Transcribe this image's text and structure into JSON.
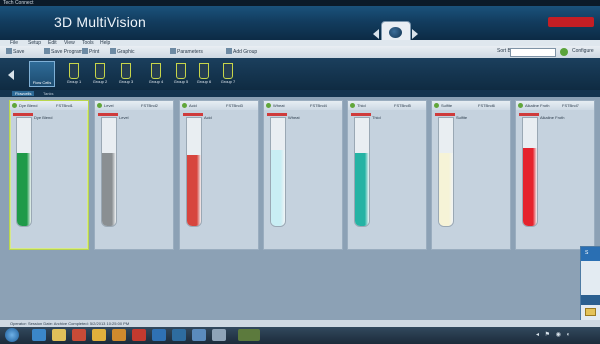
{
  "window": {
    "os_title": "Tech Connect",
    "app_title": "3D MultiVision"
  },
  "menu": [
    "File",
    "Setup",
    "Edit",
    "View",
    "Tools",
    "Help"
  ],
  "toolbar": {
    "buttons": [
      "Save",
      "Save Program",
      "Print",
      "Graphic",
      "Parameters",
      "Add Group"
    ],
    "combo_label": "Sort By",
    "configure": "Configure"
  },
  "groups": {
    "selected": "Flow Cells",
    "items": [
      "Group 1",
      "Group 2",
      "Group 3",
      "Group 4",
      "Group 5",
      "Group 6",
      "Group 7"
    ]
  },
  "tabs": [
    "Flowcells",
    "Tanks"
  ],
  "cards": [
    {
      "name": "Dye Blend",
      "code": "FSTBnd1",
      "sub": "Dye Blend",
      "fill_pct": 0.68,
      "color": "#1f9a49",
      "selected": true
    },
    {
      "name": "Level",
      "code": "FSTBnd2",
      "sub": "Level",
      "fill_pct": 0.68,
      "color": "#8a8f92",
      "selected": false
    },
    {
      "name": "Acid",
      "code": "FSTBnd3",
      "sub": "Acid",
      "fill_pct": 0.66,
      "color": "#d7453e",
      "selected": false
    },
    {
      "name": "Wheat",
      "code": "FSTBnd4",
      "sub": "Wheat",
      "fill_pct": 0.7,
      "color": "#c9eef4",
      "selected": false
    },
    {
      "name": "Thiol",
      "code": "FSTBnd5",
      "sub": "Thiol",
      "fill_pct": 0.68,
      "color": "#25b3a4",
      "selected": false
    },
    {
      "name": "Sulfite",
      "code": "FSTBnd6",
      "sub": "Sulfite",
      "fill_pct": 0.68,
      "color": "#f6f3d7",
      "selected": false
    },
    {
      "name": "Alkaline Froth",
      "code": "FSTBnd7",
      "sub": "Alkaline Froth",
      "fill_pct": 0.72,
      "color": "#e5232d",
      "selected": false
    }
  ],
  "popup": {
    "title": "S"
  },
  "status": {
    "text": "Operator: Session Date: Archive Completed: 5/2/2013 10:25:00 PM"
  }
}
